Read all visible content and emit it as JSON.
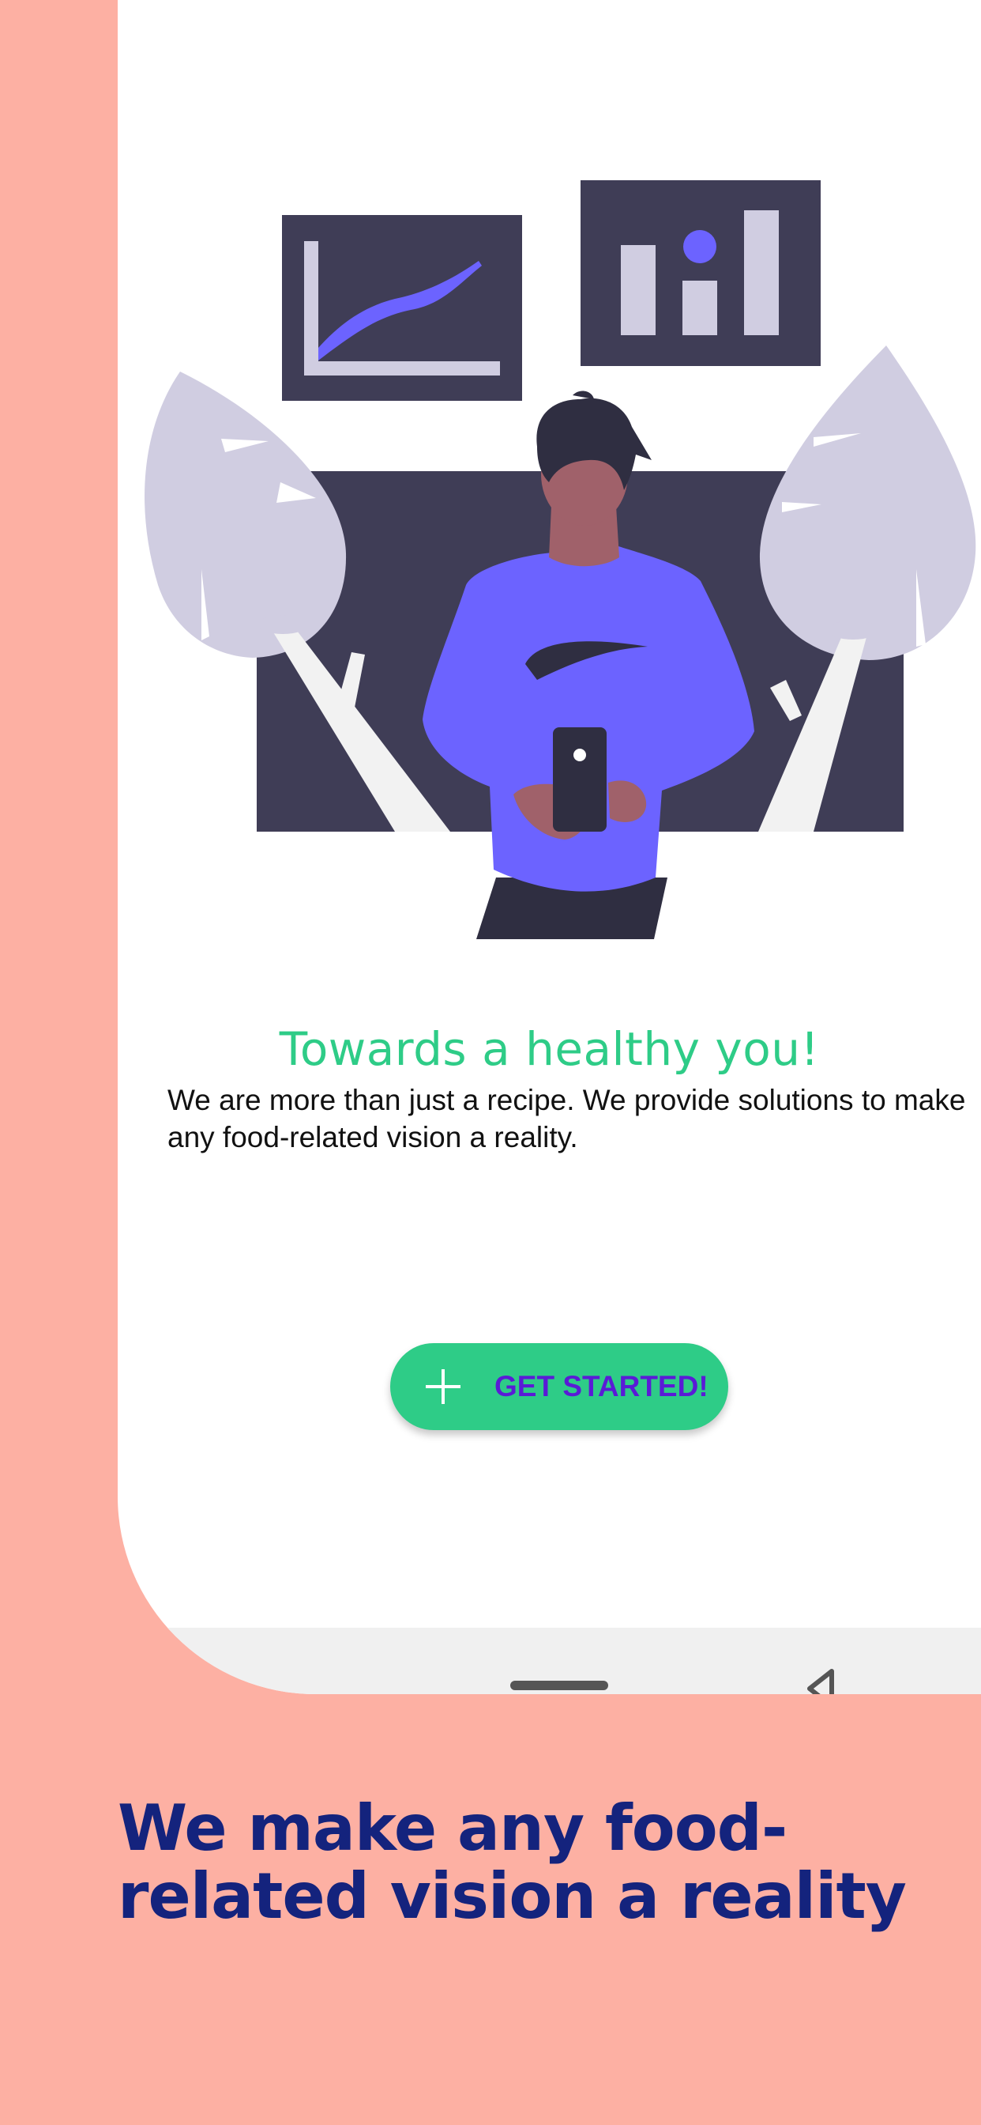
{
  "onboarding": {
    "headline": "Towards a healthy you!",
    "description": "We are more than just a recipe. We provide solutions to make any food-related vision a reality.",
    "cta_label": "GET STARTED!",
    "cta_icon": "plus-icon"
  },
  "promo": {
    "tagline": "We make any food-related vision a reality"
  },
  "navigation_bar": {
    "home_icon": "home-pill-icon",
    "back_icon": "back-triangle-icon"
  },
  "colors": {
    "background": "#FDB0A3",
    "accent_green": "#2ECC87",
    "cta_text": "#5A1BD6",
    "tagline": "#14237D",
    "illustration_dark": "#3F3D56",
    "illustration_purple": "#6C63FF"
  }
}
